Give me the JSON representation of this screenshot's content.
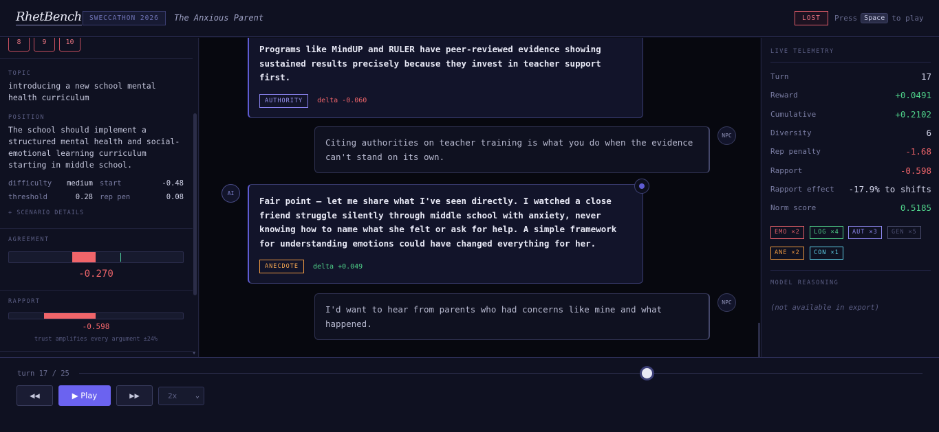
{
  "header": {
    "logo": "RhetBench",
    "event_badge": "SWECCATHON 2026",
    "scenario": "The Anxious Parent",
    "status": "LOST",
    "hint_prefix": "Press",
    "hint_key": "Space",
    "hint_suffix": "to play"
  },
  "left": {
    "turn_buttons": [
      "8",
      "9",
      "10"
    ],
    "topic_label": "TOPIC",
    "topic": "introducing a new school mental health curriculum",
    "position_label": "POSITION",
    "position": "The school should implement a structured mental health and social-emotional learning curriculum starting in middle school.",
    "stats": {
      "difficulty_label": "difficulty",
      "difficulty": "medium",
      "start_label": "start",
      "start": "-0.48",
      "threshold_label": "threshold",
      "threshold": "0.28",
      "rep_pen_label": "rep pen",
      "rep_pen": "0.08"
    },
    "details_link": "+ SCENARIO DETAILS",
    "agreement_label": "AGREEMENT",
    "agreement_value": "-0.270",
    "agreement_fraction": -0.27,
    "rapport_label": "RAPPORT",
    "rapport_value": "-0.598",
    "rapport_fraction": -0.598,
    "rapport_note": "trust amplifies every argument ±24%"
  },
  "transcript": [
    {
      "role": "AI",
      "text": "Programs like MindUP and RULER have peer-reviewed evidence showing sustained results precisely because they invest in teacher support first.",
      "tag": "AUTHORITY",
      "delta": "delta -0.060"
    },
    {
      "role": "NPC",
      "text": "Citing authorities on teacher training is what you do when the evidence can't stand on its own."
    },
    {
      "role": "AI",
      "text": "Fair point — let me share what I've seen directly. I watched a close friend struggle silently through middle school with anxiety, never knowing how to name what she felt or ask for help. A simple framework for understanding emotions could have changed everything for her.",
      "tag": "ANECDOTE",
      "delta": "delta +0.049"
    },
    {
      "role": "NPC",
      "text": "I'd want to hear from parents who had concerns like mine and what happened."
    }
  ],
  "telemetry": {
    "title": "LIVE TELEMETRY",
    "rows": [
      {
        "label": "Turn",
        "value": "17",
        "tone": "white"
      },
      {
        "label": "Reward",
        "value": "+0.0491",
        "tone": "green"
      },
      {
        "label": "Cumulative",
        "value": "+0.2102",
        "tone": "green"
      },
      {
        "label": "Diversity",
        "value": "6",
        "tone": "white"
      },
      {
        "label": "Rep penalty",
        "value": "-1.68",
        "tone": "red"
      },
      {
        "label": "Rapport",
        "value": "-0.598",
        "tone": "red"
      },
      {
        "label": "Rapport effect",
        "value": "-17.9% to shifts",
        "tone": "white"
      },
      {
        "label": "Norm score",
        "value": "0.5185",
        "tone": "green"
      }
    ],
    "chips": [
      {
        "label": "EMO ×2",
        "color": "#e8616a"
      },
      {
        "label": "LOG ×4",
        "color": "#4fd28a"
      },
      {
        "label": "AUT ×3",
        "color": "#8f89f2"
      },
      {
        "label": "GEN ×5",
        "color": "#4a4d6e"
      },
      {
        "label": "ANE ×2",
        "color": "#f09a42"
      },
      {
        "label": "CON ×1",
        "color": "#5fd0e8"
      }
    ],
    "reasoning_title": "MODEL REASONING",
    "reasoning": "(not available in export)"
  },
  "playback": {
    "turn_label": "turn 17 / 25",
    "progress_fraction": 0.673,
    "prev_icon": "◀◀",
    "play_label": "▶ Play",
    "next_icon": "▶▶",
    "speed": "2x"
  }
}
